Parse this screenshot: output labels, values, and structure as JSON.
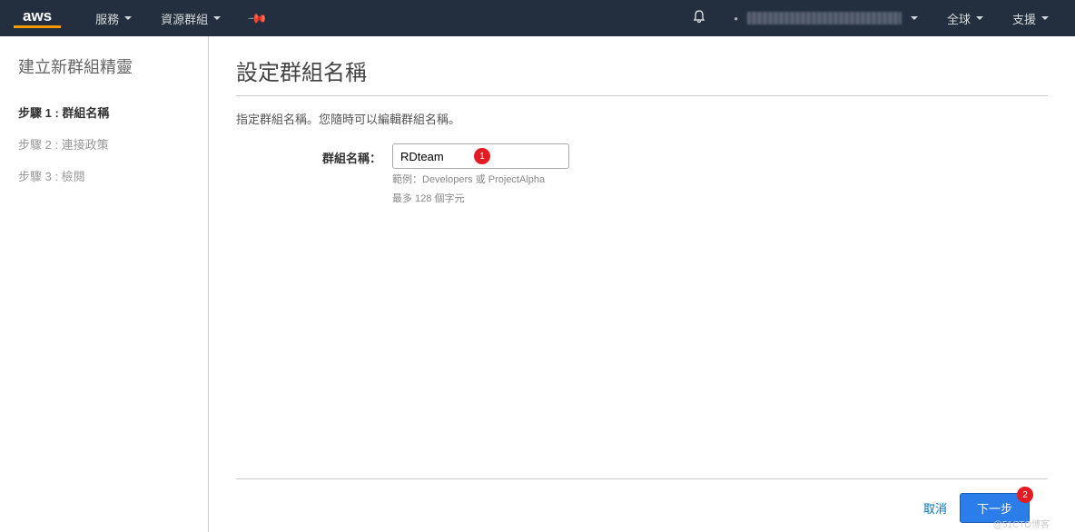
{
  "nav": {
    "logo": "aws",
    "services": "服務",
    "resource_groups": "資源群組",
    "region": "全球",
    "support": "支援"
  },
  "sidebar": {
    "title": "建立新群組精靈",
    "steps": [
      {
        "label": "步驟 1 : 群組名稱",
        "active": true
      },
      {
        "label": "步驟 2 : 連接政策",
        "active": false
      },
      {
        "label": "步驟 3 : 檢閱",
        "active": false
      }
    ]
  },
  "main": {
    "title": "設定群組名稱",
    "subtitle": "指定群組名稱。您隨時可以編輯群組名稱。",
    "field_label": "群組名稱：",
    "field_value": "RDteam",
    "helper1": "範例：Developers 或 ProjectAlpha",
    "helper2": "最多 128 個字元"
  },
  "markers": {
    "one": "1",
    "two": "2"
  },
  "footer": {
    "cancel": "取消",
    "next": "下一步"
  },
  "watermark": "@51CTO博客"
}
